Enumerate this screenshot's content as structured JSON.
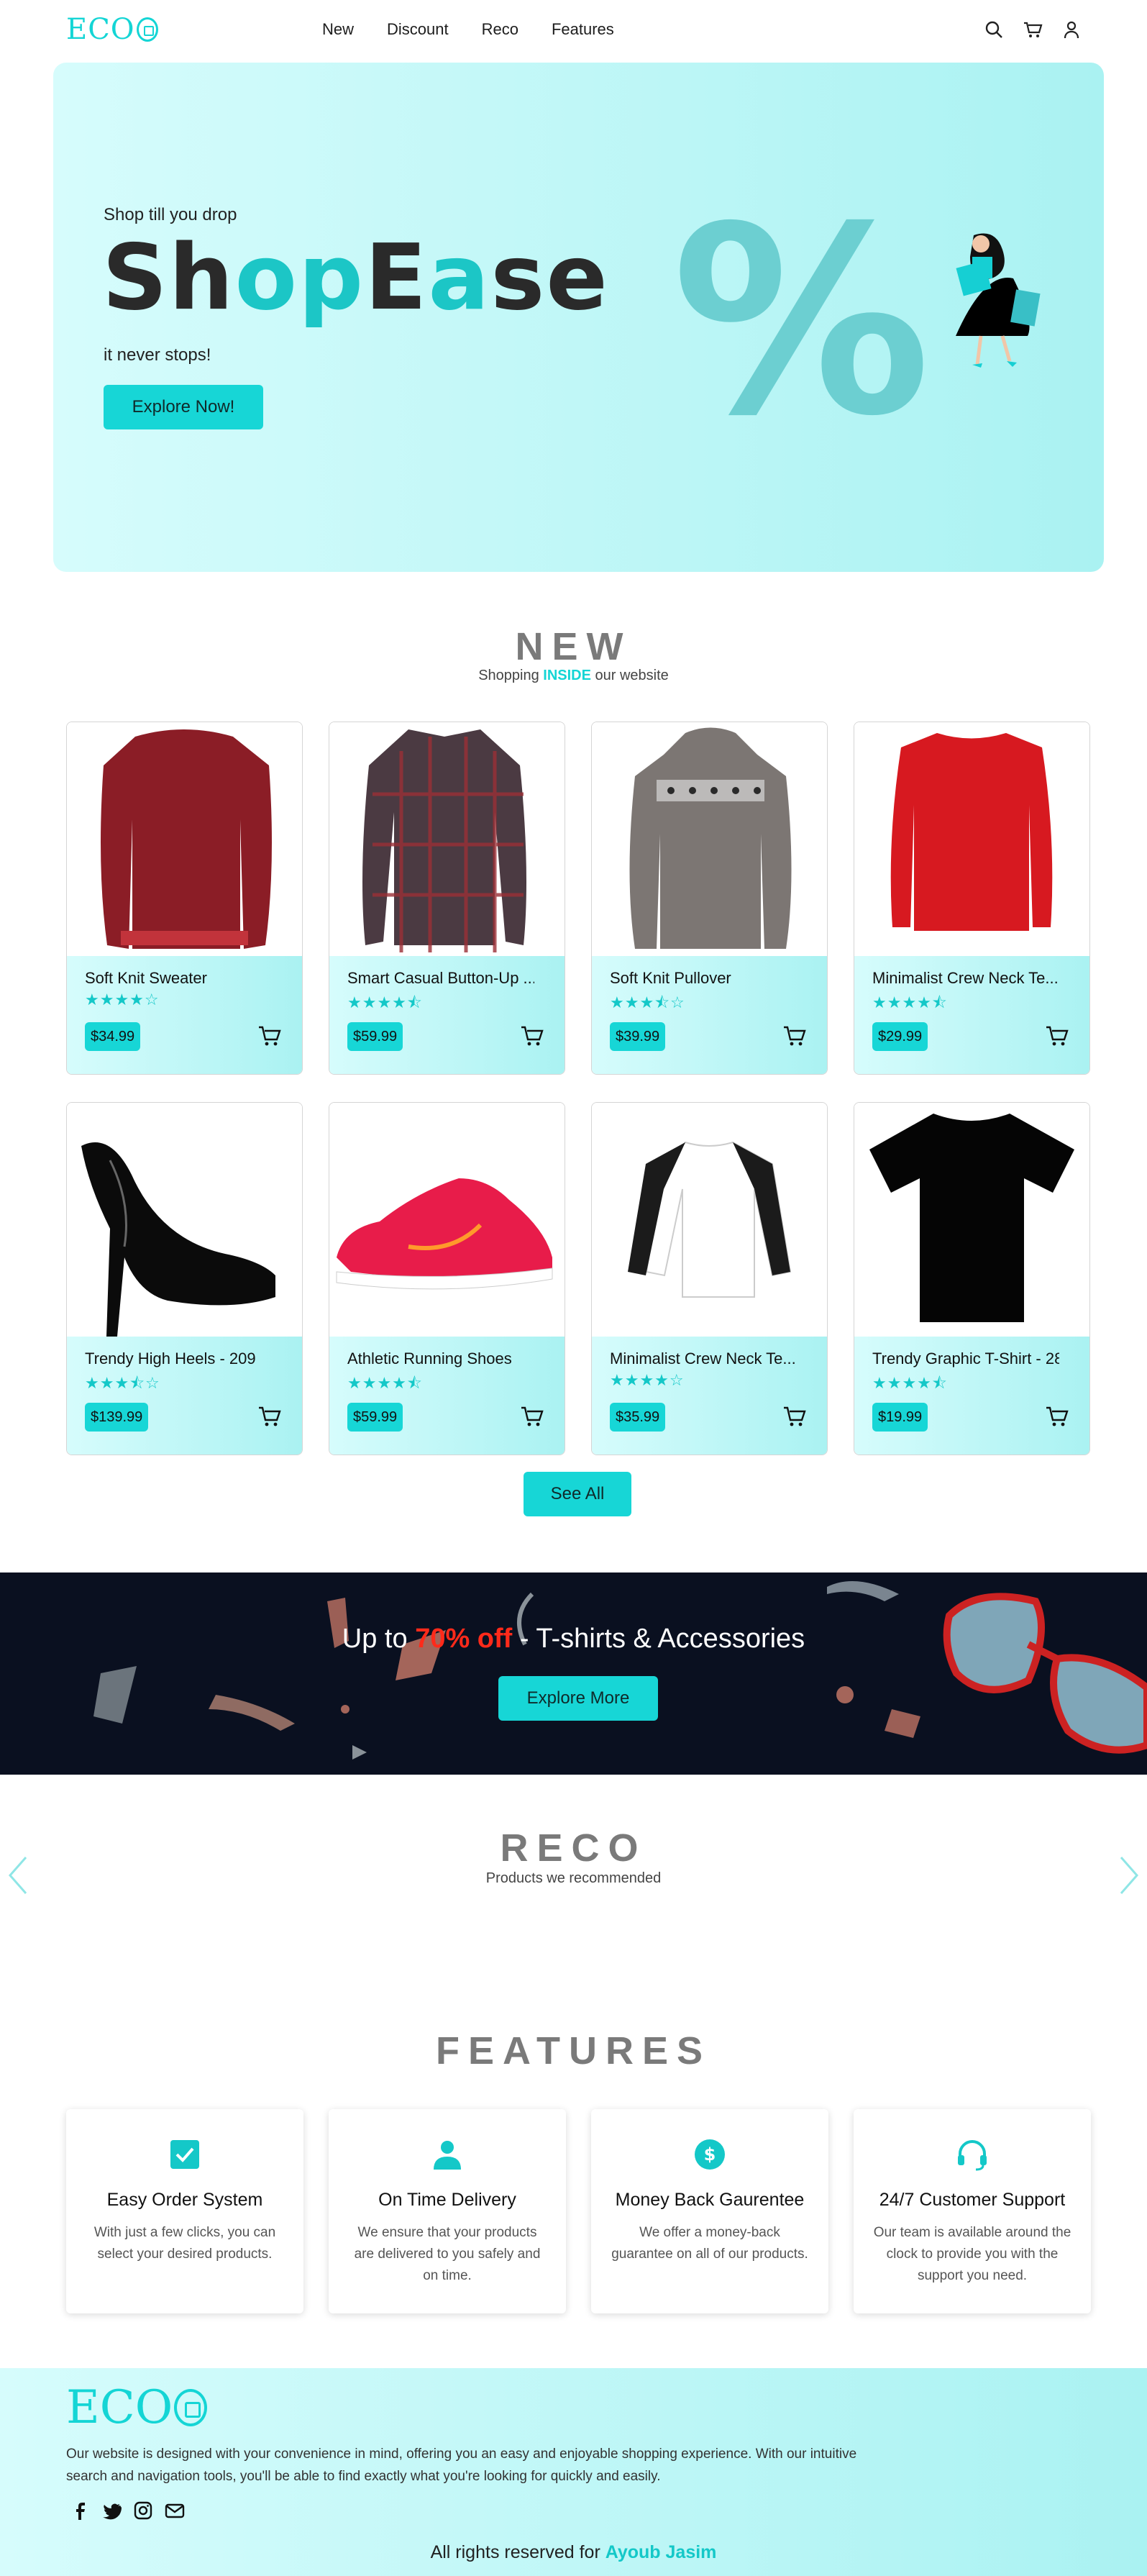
{
  "brand": {
    "logo_text": "ECO"
  },
  "nav": {
    "links": [
      "New",
      "Discount",
      "Reco",
      "Features"
    ]
  },
  "hero": {
    "tagline": "Shop till you drop",
    "title_parts": [
      "Sh",
      "o",
      "p",
      "E",
      "a",
      "se"
    ],
    "subtitle": "it never stops!",
    "cta": "Explore Now!",
    "percent_symbol": "%"
  },
  "new_section": {
    "title": "NEW",
    "subtitle_before": "Shopping ",
    "subtitle_highlight": "INSIDE",
    "subtitle_after": " our website",
    "products": [
      {
        "name": "Soft Knit Sweater",
        "stars": "★★★★☆",
        "price": "$34.99",
        "image": "sweater-red-icon"
      },
      {
        "name": "Smart Casual Button-Up ...",
        "stars": "★★★★⯪",
        "price": "$59.99",
        "image": "plaid-shirt-icon"
      },
      {
        "name": "Soft Knit Pullover",
        "stars": "★★★⯪☆",
        "price": "$39.99",
        "image": "grey-pullover-icon"
      },
      {
        "name": "Minimalist Crew Neck Te...",
        "stars": "★★★★⯪",
        "price": "$29.99",
        "image": "red-crewneck-icon"
      },
      {
        "name": "Trendy High Heels - 209",
        "stars": "★★★⯪☆",
        "price": "$139.99",
        "image": "high-heels-icon"
      },
      {
        "name": "Athletic Running Shoes",
        "stars": "★★★★⯪",
        "price": "$59.99",
        "image": "running-shoe-icon"
      },
      {
        "name": "Minimalist Crew Neck Te...",
        "stars": "★★★★☆",
        "price": "$35.99",
        "image": "raglan-tee-icon"
      },
      {
        "name": "Trendy Graphic T-Shirt - 28",
        "stars": "★★★★⯪",
        "price": "$19.99",
        "image": "black-tshirt-icon"
      }
    ],
    "see_all": "See All"
  },
  "promo": {
    "text_before": "Up to ",
    "text_highlight": "70% off",
    "text_after": " - T-shirts & Accessories",
    "cta": "Explore More"
  },
  "reco": {
    "title": "RECO",
    "subtitle": "Products we recommended"
  },
  "features": {
    "title": "FEATURES",
    "items": [
      {
        "title": "Easy Order System",
        "desc": "With just a few clicks, you can select your desired products.",
        "icon": "checkbox-icon"
      },
      {
        "title": "On Time Delivery",
        "desc": "We ensure that your products are delivered to you safely and on time.",
        "icon": "person-icon"
      },
      {
        "title": "Money Back Gaurentee",
        "desc": "We offer a money-back guarantee on all of our products.",
        "icon": "dollar-coin-icon"
      },
      {
        "title": "24/7 Customer Support",
        "desc": "Our team is available around the clock to provide you with the support you need.",
        "icon": "headset-icon"
      }
    ]
  },
  "footer": {
    "logo_text": "ECO",
    "description": "Our website is designed with your convenience in mind, offering you an easy and enjoyable shopping experience. With our intuitive search and navigation tools, you'll be able to find exactly what you're looking for quickly and easily.",
    "copyright_before": "All rights reserved for ",
    "copyright_author": "Ayoub Jasim"
  },
  "colors": {
    "accent": "#14d5d5",
    "promo_bg": "#0a1020",
    "promo_highlight": "#ff2a1a",
    "hero_bg_start": "#d6fcfc",
    "hero_bg_end": "#aaf2f2"
  }
}
